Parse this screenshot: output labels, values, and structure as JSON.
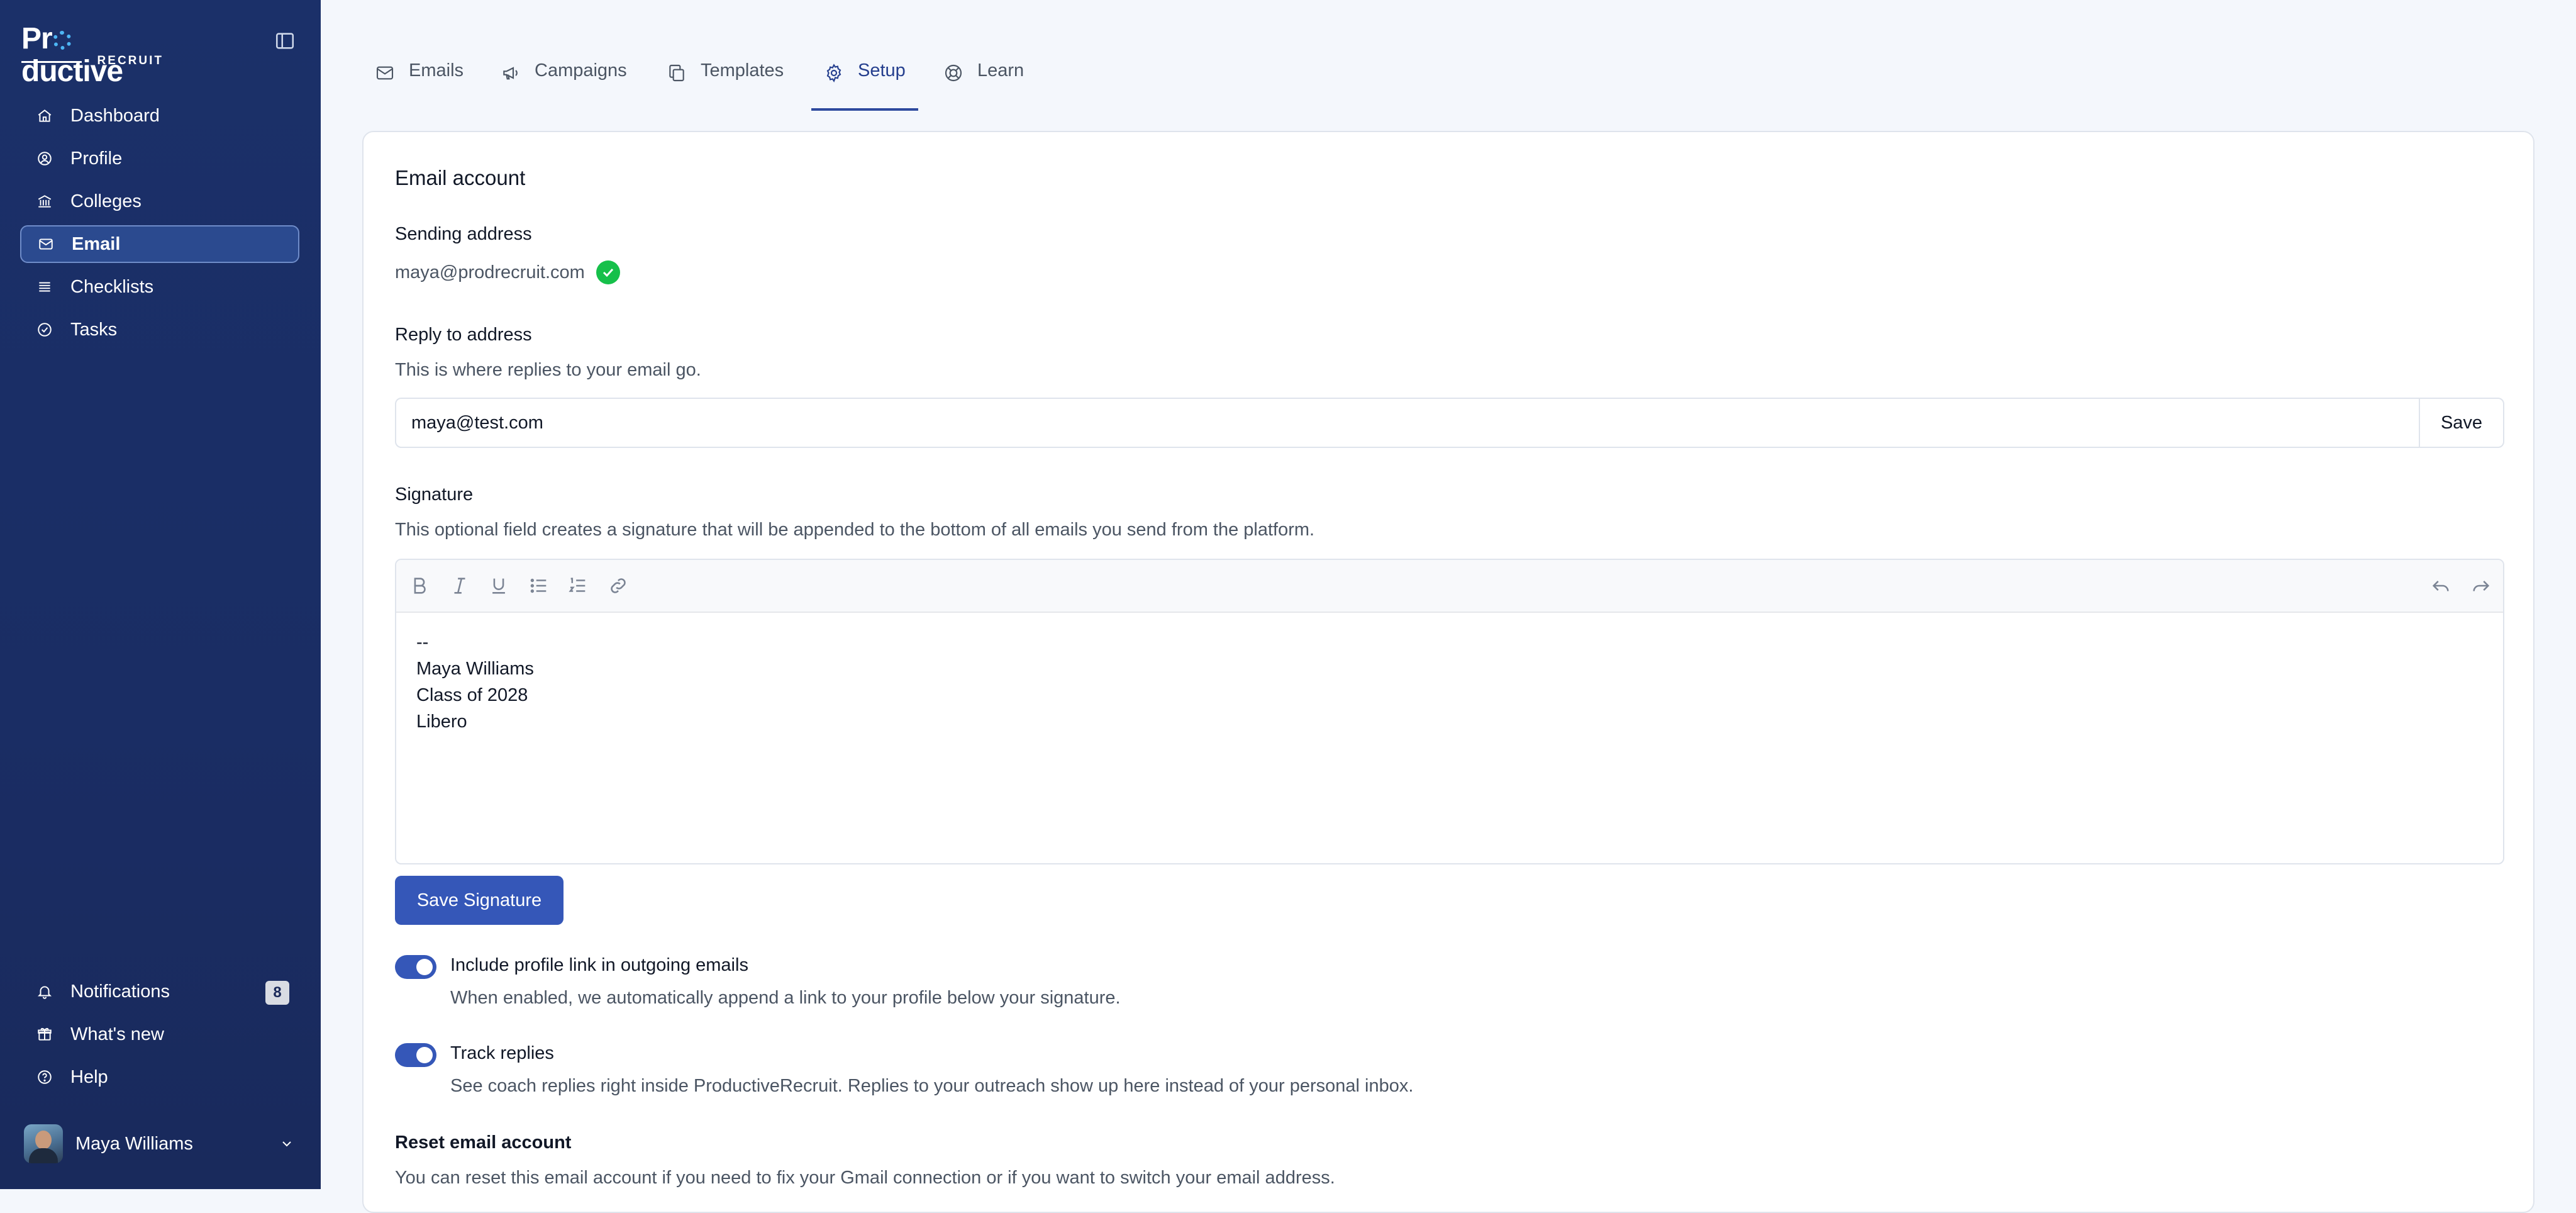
{
  "brand": {
    "name_pre": "Pr",
    "name_post": "ductive",
    "sub": "RECRUIT"
  },
  "sidebar": {
    "items": [
      {
        "label": "Dashboard",
        "icon": "home-icon"
      },
      {
        "label": "Profile",
        "icon": "user-circle-icon"
      },
      {
        "label": "Colleges",
        "icon": "building-icon"
      },
      {
        "label": "Email",
        "icon": "mail-icon",
        "active": true
      },
      {
        "label": "Checklists",
        "icon": "list-icon"
      },
      {
        "label": "Tasks",
        "icon": "check-circle-icon"
      }
    ],
    "bottom": [
      {
        "label": "Notifications",
        "icon": "bell-icon",
        "badge": "8"
      },
      {
        "label": "What's new",
        "icon": "gift-icon"
      },
      {
        "label": "Help",
        "icon": "help-icon"
      }
    ],
    "user": {
      "name": "Maya Williams"
    }
  },
  "tabs": [
    {
      "label": "Emails",
      "icon": "mail-icon"
    },
    {
      "label": "Campaigns",
      "icon": "megaphone-icon"
    },
    {
      "label": "Templates",
      "icon": "copy-icon"
    },
    {
      "label": "Setup",
      "icon": "gear-icon",
      "active": true
    },
    {
      "label": "Learn",
      "icon": "lifebuoy-icon"
    }
  ],
  "card": {
    "title": "Email account",
    "sending": {
      "label": "Sending address",
      "value": "maya@prodrecruit.com"
    },
    "reply": {
      "label": "Reply to address",
      "help": "This is where replies to your email go.",
      "value": "maya@test.com",
      "save": "Save"
    },
    "signature": {
      "label": "Signature",
      "help": "This optional field creates a signature that will be appended to the bottom of all emails you send from the platform.",
      "lines": [
        "--",
        "Maya Williams",
        "Class of 2028",
        "Libero"
      ],
      "save": "Save Signature"
    },
    "toggles": [
      {
        "label": "Include profile link in outgoing emails",
        "help": "When enabled, we automatically append a link to your profile below your signature.",
        "on": true
      },
      {
        "label": "Track replies",
        "help": "See coach replies right inside ProductiveRecruit. Replies to your outreach show up here instead of your personal inbox.",
        "on": true
      }
    ],
    "reset": {
      "label": "Reset email account",
      "help": "You can reset this email account if you need to fix your Gmail connection or if you want to switch your email address."
    }
  },
  "colors": {
    "sidebar": "#1b3069",
    "accent": "#3557b8",
    "success": "#16c04a"
  }
}
